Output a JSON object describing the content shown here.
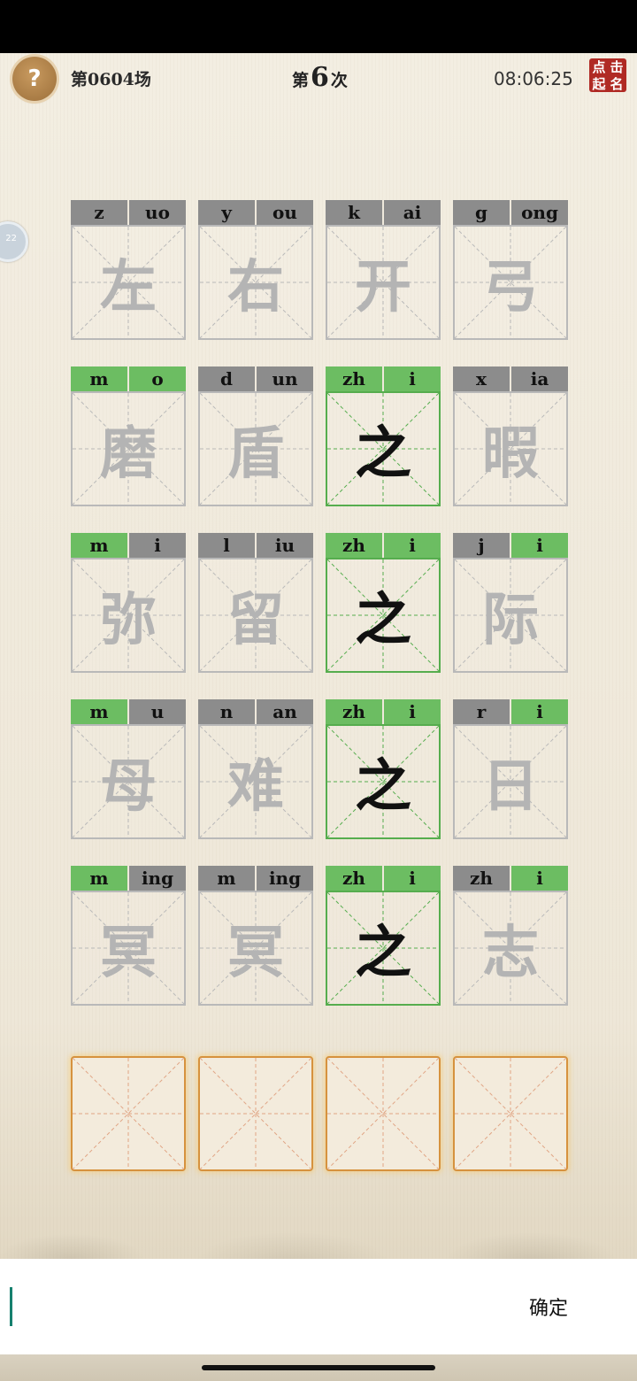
{
  "header": {
    "help_icon": "question-mark-icon",
    "help_glyph": "?",
    "round_label": "第0604场",
    "attempt_prefix": "第",
    "attempt_number": "6",
    "attempt_suffix": "次",
    "timer": "08:06:25",
    "rank_button_chars": [
      "点",
      "击",
      "起",
      "名"
    ]
  },
  "side_tab_label": "22",
  "grid_rows": [
    [
      {
        "initial": "z",
        "final": "uo",
        "char": "左",
        "initial_ok": false,
        "final_ok": false,
        "char_ok": false
      },
      {
        "initial": "y",
        "final": "ou",
        "char": "右",
        "initial_ok": false,
        "final_ok": false,
        "char_ok": false
      },
      {
        "initial": "k",
        "final": "ai",
        "char": "开",
        "initial_ok": false,
        "final_ok": false,
        "char_ok": false
      },
      {
        "initial": "g",
        "final": "ong",
        "char": "弓",
        "initial_ok": false,
        "final_ok": false,
        "char_ok": false
      }
    ],
    [
      {
        "initial": "m",
        "final": "o",
        "char": "磨",
        "initial_ok": true,
        "final_ok": true,
        "char_ok": false
      },
      {
        "initial": "d",
        "final": "un",
        "char": "盾",
        "initial_ok": false,
        "final_ok": false,
        "char_ok": false
      },
      {
        "initial": "zh",
        "final": "i",
        "char": "之",
        "initial_ok": true,
        "final_ok": true,
        "char_ok": true
      },
      {
        "initial": "x",
        "final": "ia",
        "char": "暇",
        "initial_ok": false,
        "final_ok": false,
        "char_ok": false
      }
    ],
    [
      {
        "initial": "m",
        "final": "i",
        "char": "弥",
        "initial_ok": true,
        "final_ok": false,
        "char_ok": false
      },
      {
        "initial": "l",
        "final": "iu",
        "char": "留",
        "initial_ok": false,
        "final_ok": false,
        "char_ok": false
      },
      {
        "initial": "zh",
        "final": "i",
        "char": "之",
        "initial_ok": true,
        "final_ok": true,
        "char_ok": true
      },
      {
        "initial": "j",
        "final": "i",
        "char": "际",
        "initial_ok": false,
        "final_ok": true,
        "char_ok": false
      }
    ],
    [
      {
        "initial": "m",
        "final": "u",
        "char": "母",
        "initial_ok": true,
        "final_ok": false,
        "char_ok": false
      },
      {
        "initial": "n",
        "final": "an",
        "char": "难",
        "initial_ok": false,
        "final_ok": false,
        "char_ok": false
      },
      {
        "initial": "zh",
        "final": "i",
        "char": "之",
        "initial_ok": true,
        "final_ok": true,
        "char_ok": true
      },
      {
        "initial": "r",
        "final": "i",
        "char": "日",
        "initial_ok": false,
        "final_ok": true,
        "char_ok": false
      }
    ],
    [
      {
        "initial": "m",
        "final": "ing",
        "char": "冥",
        "initial_ok": true,
        "final_ok": false,
        "char_ok": false
      },
      {
        "initial": "m",
        "final": "ing",
        "char": "冥",
        "initial_ok": false,
        "final_ok": false,
        "char_ok": false
      },
      {
        "initial": "zh",
        "final": "i",
        "char": "之",
        "initial_ok": true,
        "final_ok": true,
        "char_ok": true
      },
      {
        "initial": "zh",
        "final": "i",
        "char": "志",
        "initial_ok": false,
        "final_ok": true,
        "char_ok": false
      }
    ]
  ],
  "answer_slot_count": 4,
  "input_bar": {
    "value": "",
    "confirm_label": "确定"
  },
  "colors": {
    "correct": "#6cbd62",
    "neutral": "#8c8c8c",
    "slot_border": "#d6923e",
    "rank_button": "#b02a24"
  }
}
